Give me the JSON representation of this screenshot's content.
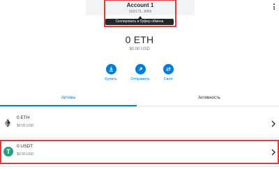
{
  "header": {
    "account_name": "Account 1",
    "account_address": "0xD173...89Nl",
    "tooltip": "Скопировать в буфер обмена",
    "menu_icon": "kebab-menu-icon"
  },
  "balance": {
    "main": "0 ETH",
    "usd": "$0.00 USD"
  },
  "actions": [
    {
      "label": "Купить",
      "icon": "download-icon"
    },
    {
      "label": "Отправить",
      "icon": "arrow-up-right-icon"
    },
    {
      "label": "Своп",
      "icon": "swap-icon"
    }
  ],
  "tabs": [
    {
      "label": "Активы",
      "active": true
    },
    {
      "label": "Активность",
      "active": false
    }
  ],
  "assets": [
    {
      "amount": "0 ETH",
      "usd": "$0.00 USD",
      "icon": "ethereum-icon"
    },
    {
      "amount": "0 USDT",
      "usd": "$0.00 USD",
      "icon": "tether-icon",
      "icon_text": "T"
    }
  ],
  "colors": {
    "accent": "#037dd6",
    "highlight": "#e53935",
    "tether": "#26a17b"
  }
}
